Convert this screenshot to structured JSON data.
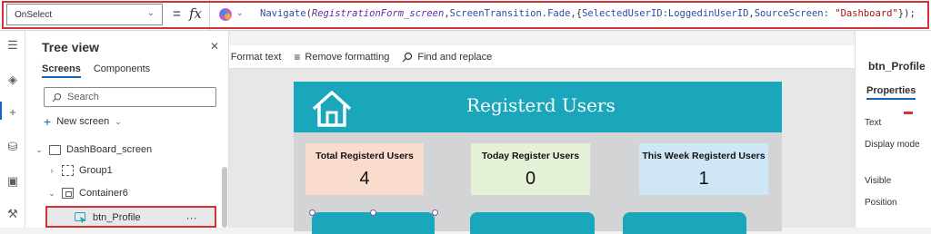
{
  "formula_bar": {
    "property": "OnSelect",
    "equals": "=",
    "fx": "fx",
    "code": {
      "fn": "Navigate",
      "open": "(",
      "arg_screen": "RegistrationForm_screen",
      "comma1": ",",
      "transition": "ScreenTransition.Fade",
      "comma2": ",{",
      "key1": "SelectedUserID:",
      "val1": "LoggedinUserID",
      "comma3": ",",
      "key2": "SourceScreen: ",
      "val2": "\"Dashboard\"",
      "close": "});"
    }
  },
  "format_toolbar": {
    "format_text": "Format text",
    "remove_formatting": "Remove formatting",
    "find_replace": "Find and replace"
  },
  "tree_view": {
    "title": "Tree view",
    "tabs": [
      "Screens",
      "Components"
    ],
    "search_placeholder": "Search",
    "new_screen": "New screen",
    "nodes": [
      {
        "label": "DashBoard_screen"
      },
      {
        "label": "Group1"
      },
      {
        "label": "Container6"
      },
      {
        "label": "btn_Profile"
      }
    ],
    "more": "···"
  },
  "app": {
    "title": "Registerd Users",
    "stats": [
      {
        "label": "Total Registerd Users",
        "value": "4",
        "color": "#fadccf"
      },
      {
        "label": "Today Register Users",
        "value": "0",
        "color": "#e4f1d7"
      },
      {
        "label": "This Week Registerd Users",
        "value": "1",
        "color": "#cfe6f6"
      }
    ]
  },
  "props_panel": {
    "name": "btn_Profile",
    "tab": "Properties",
    "rows": [
      "Text",
      "Display mode",
      "Visible",
      "Position"
    ]
  },
  "colors": {
    "accent": "#1ba7bb",
    "highlight_border": "#d13438",
    "link_blue": "#1066b9"
  }
}
